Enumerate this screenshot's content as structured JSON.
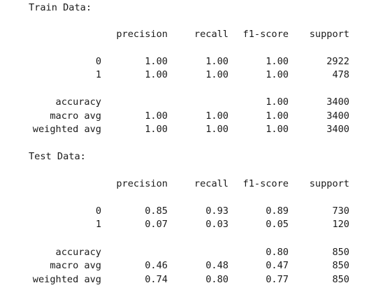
{
  "train": {
    "title": "Train Data:",
    "headers": [
      "precision",
      "recall",
      "f1-score",
      "support"
    ],
    "rows": [
      {
        "label": "0",
        "precision": "1.00",
        "recall": "1.00",
        "f1": "1.00",
        "support": "2922"
      },
      {
        "label": "1",
        "precision": "1.00",
        "recall": "1.00",
        "f1": "1.00",
        "support": "478"
      }
    ],
    "summary": [
      {
        "label": "accuracy",
        "precision": "",
        "recall": "",
        "f1": "1.00",
        "support": "3400"
      },
      {
        "label": "macro avg",
        "precision": "1.00",
        "recall": "1.00",
        "f1": "1.00",
        "support": "3400"
      },
      {
        "label": "weighted avg",
        "precision": "1.00",
        "recall": "1.00",
        "f1": "1.00",
        "support": "3400"
      }
    ]
  },
  "test": {
    "title": "Test Data:",
    "headers": [
      "precision",
      "recall",
      "f1-score",
      "support"
    ],
    "rows": [
      {
        "label": "0",
        "precision": "0.85",
        "recall": "0.93",
        "f1": "0.89",
        "support": "730"
      },
      {
        "label": "1",
        "precision": "0.07",
        "recall": "0.03",
        "f1": "0.05",
        "support": "120"
      }
    ],
    "summary": [
      {
        "label": "accuracy",
        "precision": "",
        "recall": "",
        "f1": "0.80",
        "support": "850"
      },
      {
        "label": "macro avg",
        "precision": "0.46",
        "recall": "0.48",
        "f1": "0.47",
        "support": "850"
      },
      {
        "label": "weighted avg",
        "precision": "0.74",
        "recall": "0.80",
        "f1": "0.77",
        "support": "850"
      }
    ]
  }
}
